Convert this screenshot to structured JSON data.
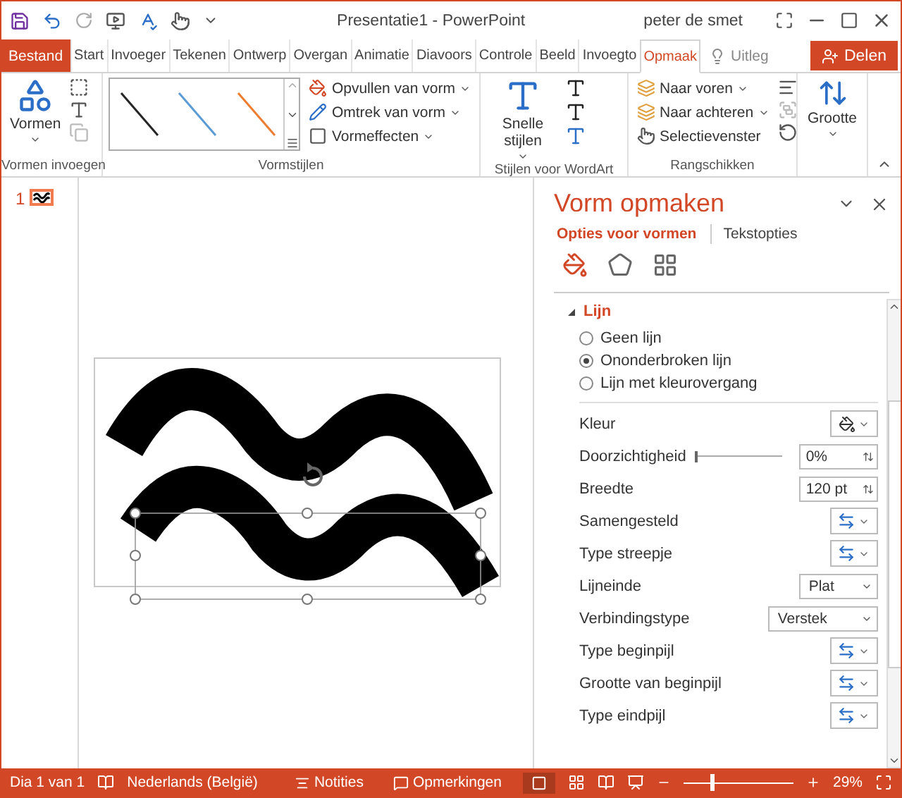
{
  "title_bar": {
    "title": "Presentatie1 - PowerPoint",
    "user": "peter de smet"
  },
  "tabs": [
    {
      "label": "Bestand",
      "kind": "file",
      "selected": false
    },
    {
      "label": "Start",
      "kind": "tab",
      "selected": false
    },
    {
      "label": "Invoeger",
      "kind": "tab",
      "selected": false
    },
    {
      "label": "Tekenen",
      "kind": "tab",
      "selected": false
    },
    {
      "label": "Ontwerp",
      "kind": "tab",
      "selected": false
    },
    {
      "label": "Overgan",
      "kind": "tab",
      "selected": false
    },
    {
      "label": "Animatie",
      "kind": "tab",
      "selected": false
    },
    {
      "label": "Diavoors",
      "kind": "tab",
      "selected": false
    },
    {
      "label": "Controle",
      "kind": "tab",
      "selected": false
    },
    {
      "label": "Beeld",
      "kind": "tab",
      "selected": false
    },
    {
      "label": "Invoegto",
      "kind": "tab",
      "selected": false
    },
    {
      "label": "Opmaak",
      "kind": "tab",
      "selected": true
    },
    {
      "label": "Uitleg",
      "kind": "tell",
      "selected": false
    }
  ],
  "share_button": "Delen",
  "ribbon": {
    "groups": [
      {
        "kind": "insert",
        "label": "Vormen invoegen",
        "buttons": [
          {
            "label": "Vormen",
            "kind": "large"
          }
        ]
      },
      {
        "kind": "styles",
        "label": "Vormstijlen",
        "gallery": [
          {
            "color": "#262626"
          },
          {
            "color": "#5b9bd5"
          },
          {
            "color": "#ed7d31"
          }
        ],
        "buttons": [
          {
            "label": "Opvullen van vorm",
            "kind": "small"
          },
          {
            "label": "Omtrek van vorm",
            "kind": "small"
          },
          {
            "label": "Vormeffecten",
            "kind": "small"
          }
        ]
      },
      {
        "kind": "wordart",
        "label": "Stijlen voor WordArt",
        "buttons": [
          {
            "label": "Snelle stijlen",
            "kind": "large"
          }
        ]
      },
      {
        "kind": "arrange",
        "label": "Rangschikken",
        "buttons": [
          {
            "label": "Naar voren",
            "kind": "small"
          },
          {
            "label": "Naar achteren",
            "kind": "small"
          },
          {
            "label": "Selectievenster",
            "kind": "small"
          }
        ]
      },
      {
        "kind": "size",
        "buttons": [
          {
            "label": "Grootte",
            "kind": "large"
          }
        ]
      }
    ]
  },
  "thumbnails": [
    {
      "number": "1",
      "selected": true
    }
  ],
  "panel": {
    "title": "Vorm opmaken",
    "subtabs": [
      {
        "label": "Opties voor vormen",
        "selected": true
      },
      {
        "label": "Tekstopties",
        "selected": false
      }
    ],
    "section": {
      "label": "Lijn",
      "expanded": true
    },
    "radios": [
      {
        "label": "Geen lijn",
        "selected": false
      },
      {
        "label": "Ononderbroken lijn",
        "selected": true
      },
      {
        "label": "Lijn met kleurovergang",
        "selected": false
      }
    ],
    "properties": [
      {
        "label": "Kleur",
        "kind": "color"
      },
      {
        "label": "Doorzichtigheid",
        "kind": "slider",
        "level": 0,
        "value": "0%"
      },
      {
        "label": "Breedte",
        "kind": "spin",
        "value": "120 pt"
      },
      {
        "label": "Samengesteld",
        "kind": "icon"
      },
      {
        "label": "Type streepje",
        "kind": "icon"
      },
      {
        "label": "Lijneinde",
        "kind": "dropdown",
        "value": "Plat"
      },
      {
        "label": "Verbindingstype",
        "kind": "wide-dropdown",
        "value": "Verstek"
      },
      {
        "label": "Type beginpijl",
        "kind": "icon"
      },
      {
        "label": "Grootte van beginpijl",
        "kind": "icon"
      },
      {
        "label": "Type eindpijl",
        "kind": "icon"
      }
    ]
  },
  "status_bar": {
    "slide": "Dia 1 van 1",
    "language": "Nederlands (België)",
    "notes": "Notities",
    "comments": "Opmerkingen",
    "zoom": {
      "level": 0.25,
      "reading": "29%"
    }
  }
}
